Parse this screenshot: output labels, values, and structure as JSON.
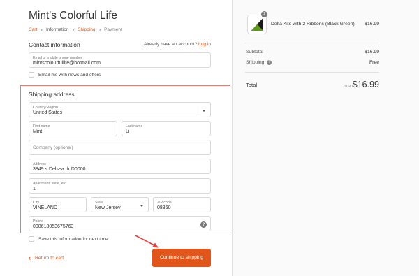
{
  "store": {
    "title": "Mint's Colorful Life"
  },
  "breadcrumb": [
    {
      "label": "Cart",
      "state": "link"
    },
    {
      "label": "Information",
      "state": "current"
    },
    {
      "label": "Shipping",
      "state": "link"
    },
    {
      "label": "Payment",
      "state": "muted"
    }
  ],
  "breadcrumb_separator": "›",
  "contact": {
    "title": "Contact information",
    "have_account_text": "Already have an account?",
    "login_link": "Log in",
    "email_label": "Email or mobile phone number",
    "email_value": "mintscolourfullife@hotmail.com",
    "news_checkbox_label": "Email me with news and offers"
  },
  "shipping": {
    "title": "Shipping address",
    "country_label": "Country/Region",
    "country_value": "United States",
    "first_name_label": "First name",
    "first_name_value": "Mint",
    "last_name_label": "Last name",
    "last_name_value": "Li",
    "company_placeholder": "Company (optional)",
    "address_label": "Address",
    "address_value": "3849 s Delsea dr D0000",
    "apt_label": "Apartment, suite, etc",
    "apt_value": "1",
    "city_label": "City",
    "city_value": "VINELAND",
    "state_label": "State",
    "state_value": "New Jersey",
    "zip_label": "ZIP code",
    "zip_value": "08360",
    "phone_label": "Phone",
    "phone_value": "008618053675763",
    "help_glyph": "?"
  },
  "save_info_label": "Save this information for next time",
  "actions": {
    "return_chevron": "‹",
    "return_label": "Return to cart",
    "continue_label": "Continue to shipping"
  },
  "order_summary": {
    "product": {
      "quantity": "1",
      "name": "Delta Kite with 2 Ribbons (Black Green)",
      "price": "$16.99"
    },
    "subtotal_label": "Subtotal",
    "subtotal_value": "$16.99",
    "shipping_label": "Shipping",
    "shipping_help": "?",
    "shipping_value": "Free",
    "total_label": "Total",
    "total_currency": "USD",
    "total_value": "$16.99"
  },
  "colors": {
    "accent": "#e0561b",
    "highlight_box": "#e07a72",
    "arrow": "#e8403a",
    "kite_black": "#1a1a1a",
    "kite_green": "#7ab51d"
  }
}
